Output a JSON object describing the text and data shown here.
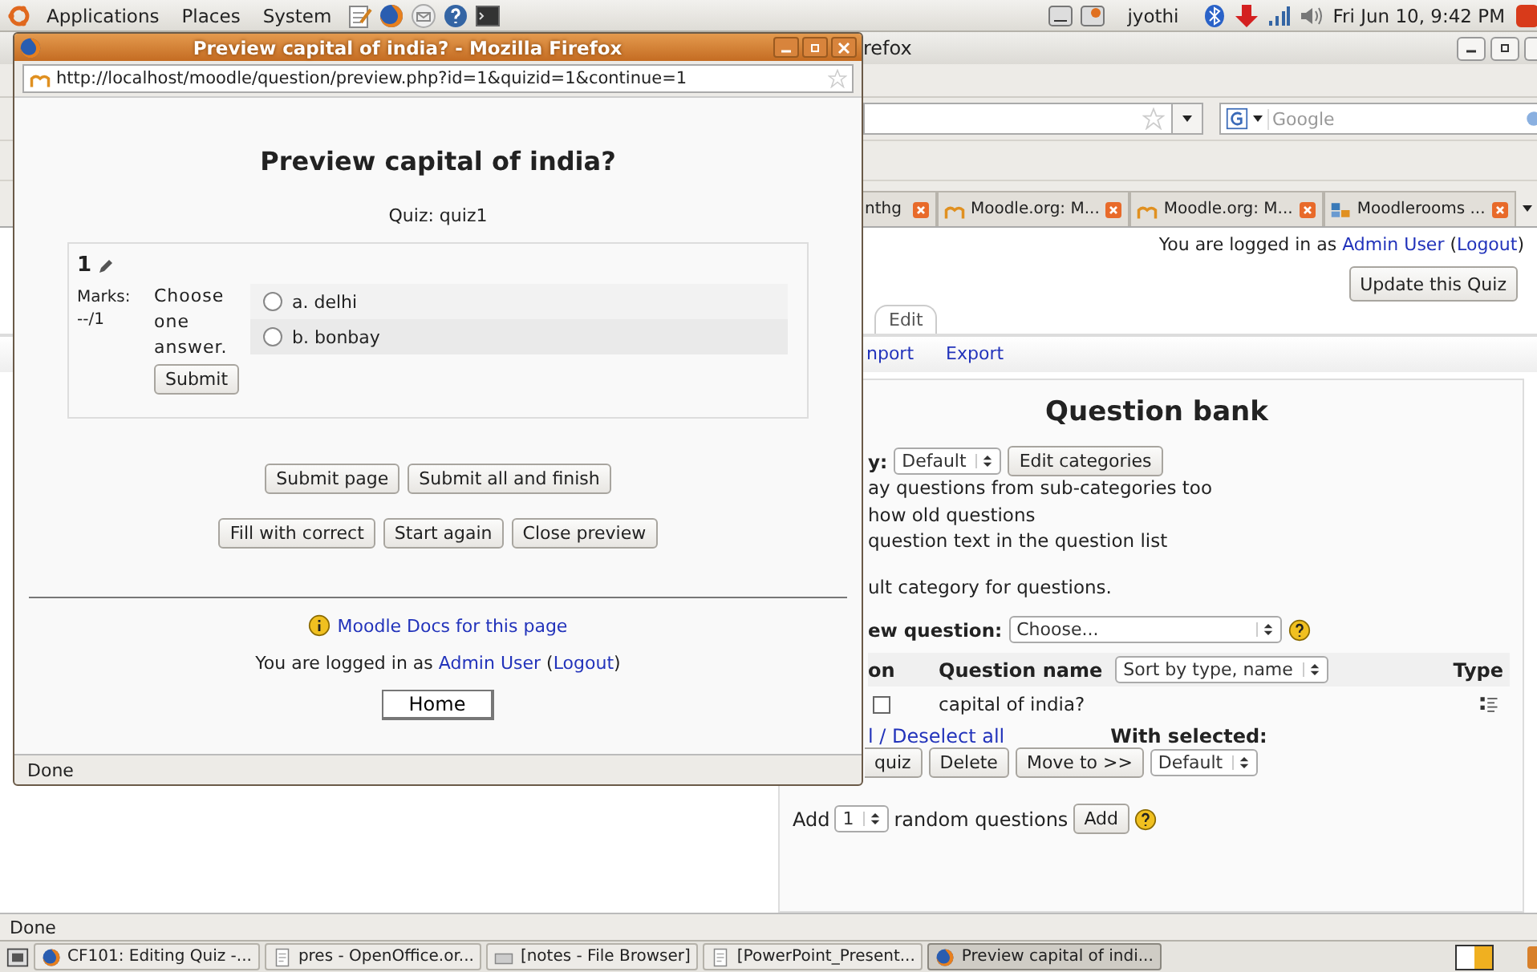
{
  "top_panel": {
    "menus": [
      "Applications",
      "Places",
      "System"
    ],
    "user": "jyothi",
    "clock": "Fri Jun 10,  9:42 PM"
  },
  "background_window": {
    "title": "refox",
    "search": {
      "placeholder": "Google"
    },
    "tabs": [
      {
        "label": "nthg",
        "selected": false
      },
      {
        "label": "Moodle.org: M...",
        "selected": false
      },
      {
        "label": "Moodle.org: M...",
        "selected": false
      },
      {
        "label": "Moodlerooms ...",
        "selected": false
      }
    ],
    "login": {
      "before": "You are logged in as ",
      "user": "Admin User",
      "between": " (",
      "logout": "Logout",
      "after": ")"
    },
    "update_button": "Update this Quiz",
    "page_tabs": [
      {
        "label": "Edit",
        "selected": true
      }
    ],
    "links": [
      "nport",
      "Export"
    ],
    "question_bank": {
      "title": "Question bank",
      "category_label": "y:",
      "category_value": "Default",
      "edit_categories": "Edit categories",
      "options": [
        "ay questions from sub-categories too",
        "how old questions",
        "question text in the question list"
      ],
      "default_note": "ult category for questions.",
      "create_label": "ew question:",
      "create_value": "Choose...",
      "columns": [
        "on",
        "Question name",
        "Type"
      ],
      "sort_value": "Sort by type, name",
      "rows": [
        {
          "name": "capital of india?",
          "checked": false
        }
      ],
      "select_links": "l / Deselect all",
      "with_selected": "With selected:",
      "actions": [
        "quiz",
        "Delete",
        "Move to >>"
      ],
      "move_target": "Default",
      "add_before": "Add",
      "add_count": "1",
      "add_after": "random questions",
      "add_button": "Add"
    },
    "status": "Done"
  },
  "popup": {
    "title": "Preview capital of india? - Mozilla Firefox",
    "url": "http://localhost/moodle/question/preview.php?id=1&quizid=1&continue=1",
    "heading": "Preview capital of india?",
    "quiz": "Quiz: quiz1",
    "question": {
      "number": "1",
      "marks_label": "Marks:",
      "marks": "--/1",
      "prompt": "Choose one answer.",
      "submit": "Submit",
      "answers": [
        {
          "label": "a. delhi",
          "checked": false
        },
        {
          "label": "b. bonbay",
          "checked": false
        }
      ]
    },
    "button_rows": [
      [
        "Submit page",
        "Submit all and finish"
      ],
      [
        "Fill with correct",
        "Start again",
        "Close preview"
      ]
    ],
    "docs_link": "Moodle Docs for this page",
    "login": {
      "before": "You are logged in as ",
      "user": "Admin User",
      "between": " (",
      "logout": "Logout",
      "after": ")"
    },
    "home": "Home",
    "status": "Done"
  },
  "taskbar": [
    {
      "label": "CF101: Editing Quiz -...",
      "kind": "browser",
      "selected": false
    },
    {
      "label": "pres - OpenOffice.or...",
      "kind": "document",
      "selected": false
    },
    {
      "label": "[notes - File Browser]",
      "kind": "folder",
      "selected": false
    },
    {
      "label": "[PowerPoint_Present...",
      "kind": "document",
      "selected": false
    },
    {
      "label": "Preview capital of indi...",
      "kind": "browser",
      "selected": true
    }
  ]
}
